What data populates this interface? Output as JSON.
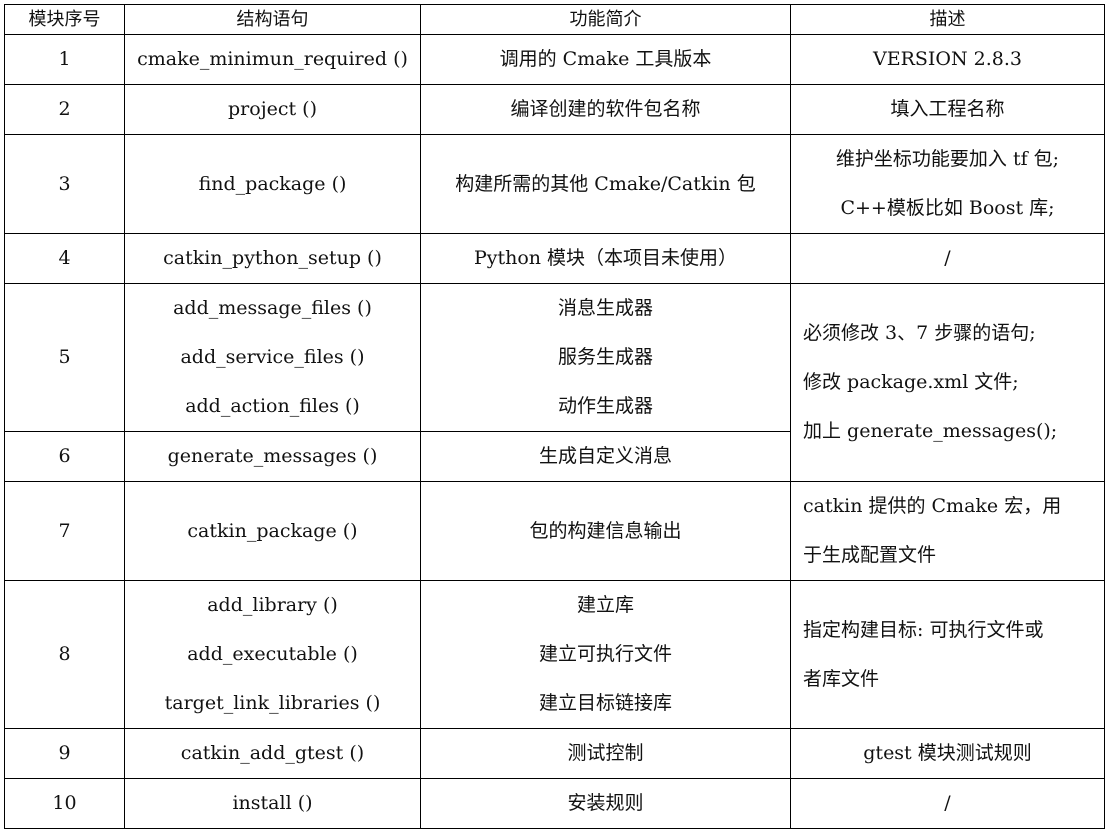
{
  "headers": [
    "模块序号",
    "结构语句",
    "功能简介",
    "描述"
  ],
  "rows": [
    {
      "no": "1",
      "stmt": [
        "cmake_minimun_required ()"
      ],
      "func": [
        "调用的 Cmake 工具版本"
      ],
      "desc": [
        "VERSION 2.8.3"
      ]
    },
    {
      "no": "2",
      "stmt": [
        "project ()"
      ],
      "func": [
        "编译创建的软件包名称"
      ],
      "desc": [
        "填入工程名称"
      ]
    },
    {
      "no": "3",
      "stmt": [
        "find_package ()"
      ],
      "func": [
        "构建所需的其他 Cmake/Catkin 包"
      ],
      "desc": [
        "维护坐标功能要加入 tf 包;",
        "C++模板比如 Boost 库;"
      ]
    },
    {
      "no": "4",
      "stmt": [
        "catkin_python_setup ()"
      ],
      "func": [
        "Python 模块（本项目未使用）"
      ],
      "desc": [
        "/"
      ]
    },
    {
      "no": "5",
      "stmt": [
        "add_message_files ()",
        "add_service_files ()",
        "add_action_files ()"
      ],
      "func": [
        "消息生成器",
        "服务生成器",
        "动作生成器"
      ],
      "desc": [
        "必须修改 3、7 步骤的语句;",
        "修改 package.xml 文件;",
        "加上 generate_messages();"
      ]
    },
    {
      "no": "6",
      "stmt": [
        "generate_messages ()"
      ],
      "func": [
        "生成自定义消息"
      ]
    },
    {
      "no": "7",
      "stmt": [
        "catkin_package ()"
      ],
      "func": [
        "包的构建信息输出"
      ],
      "desc": [
        "catkin 提供的 Cmake 宏，用",
        "于生成配置文件"
      ]
    },
    {
      "no": "8",
      "stmt": [
        "add_library ()",
        "add_executable ()",
        "target_link_libraries ()"
      ],
      "func": [
        "建立库",
        "建立可执行文件",
        "建立目标链接库"
      ],
      "desc": [
        "指定构建目标: 可执行文件或",
        "者库文件"
      ]
    },
    {
      "no": "9",
      "stmt": [
        "catkin_add_gtest ()"
      ],
      "func": [
        "测试控制"
      ],
      "desc": [
        "gtest 模块测试规则"
      ]
    },
    {
      "no": "10",
      "stmt": [
        "install ()"
      ],
      "func": [
        "安装规则"
      ],
      "desc": [
        "/"
      ]
    }
  ]
}
